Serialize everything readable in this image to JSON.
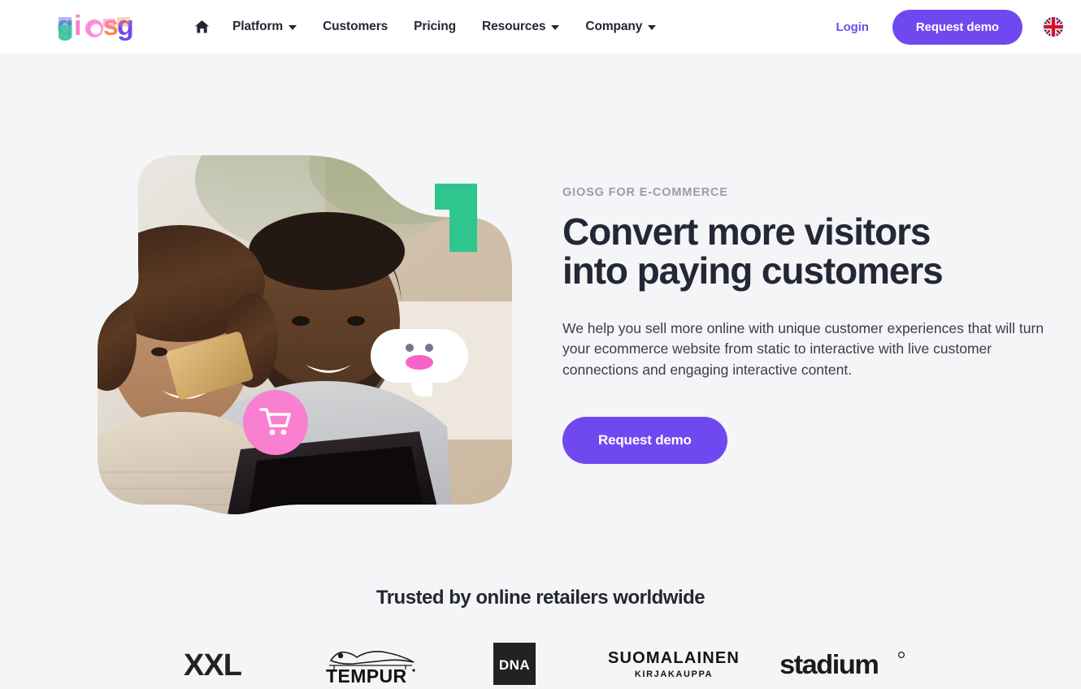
{
  "brand": {
    "name": "giosg",
    "letters": [
      {
        "char": "g",
        "color": "#3ec9a0"
      },
      {
        "char": "i",
        "color": "#f97fd0"
      },
      {
        "char": "o",
        "color": "#f97fd0"
      },
      {
        "char": "s",
        "color": "#f98a4e"
      },
      {
        "char": "g",
        "color": "#7048f0"
      }
    ]
  },
  "header": {
    "nav": [
      {
        "label": "",
        "icon": "home-icon",
        "has_caret": false
      },
      {
        "label": "Platform",
        "icon": "",
        "has_caret": true
      },
      {
        "label": "Customers",
        "icon": "",
        "has_caret": false
      },
      {
        "label": "Pricing",
        "icon": "",
        "has_caret": false
      },
      {
        "label": "Resources",
        "icon": "",
        "has_caret": true
      },
      {
        "label": "Company",
        "icon": "",
        "has_caret": true
      }
    ],
    "login_label": "Login",
    "demo_label": "Request demo",
    "language_icon": "uk-flag-icon",
    "accent_color": "#7048f0"
  },
  "hero": {
    "eyebrow": "GIOSG FOR E-COMMERCE",
    "title_line1": "Convert more visitors",
    "title_line2": "into paying customers",
    "body": "We help you sell more online with unique customer experiences that will turn your ecommerce website from static to interactive with live customer connections and engaging interactive content.",
    "cta_label": "Request demo",
    "decorations": {
      "green_shape_color": "#2ec58f",
      "cart_badge_color": "#f97fd0",
      "cart_icon": "shopping-cart-icon",
      "chat_icon": "chat-bubble-smiley-icon",
      "chat_mouth_color": "#f763c7",
      "chat_eye_color": "#75758c"
    }
  },
  "trusted": {
    "title": "Trusted by online retailers worldwide",
    "logos": [
      {
        "name": "XXL",
        "id": "xxl-logo"
      },
      {
        "name": "TEMPUR",
        "id": "tempur-logo"
      },
      {
        "name": "DNA",
        "id": "dna-logo"
      },
      {
        "name": "SUOMALAINEN",
        "sub": "KIRJAKAUPPA",
        "id": "suomalainen-kirjakauppa-logo"
      },
      {
        "name": "stadium",
        "id": "stadium-logo"
      }
    ]
  }
}
